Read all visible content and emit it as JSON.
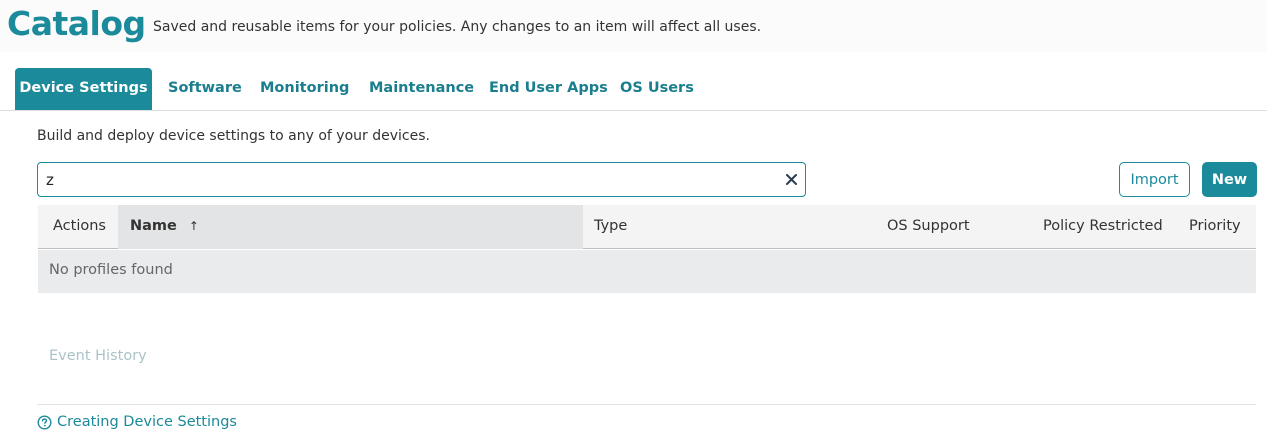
{
  "header": {
    "title": "Catalog",
    "subtitle": "Saved and reusable items for your policies. Any changes to an item will affect all uses."
  },
  "tabs": [
    {
      "label": "Device Settings",
      "active": true
    },
    {
      "label": "Software",
      "active": false
    },
    {
      "label": "Monitoring",
      "active": false
    },
    {
      "label": "Maintenance",
      "active": false
    },
    {
      "label": "End User Apps",
      "active": false
    },
    {
      "label": "OS Users",
      "active": false
    }
  ],
  "main": {
    "intro": "Build and deploy device settings to any of your devices.",
    "search": {
      "value": "z",
      "clear_icon": "close-icon"
    },
    "import_label": "Import",
    "new_label": "New"
  },
  "table": {
    "columns": [
      {
        "label": "Actions"
      },
      {
        "label": "Name",
        "sorted": true,
        "sort_icon": "↑"
      },
      {
        "label": "Type"
      },
      {
        "label": "OS Support"
      },
      {
        "label": "Policy Restricted"
      },
      {
        "label": "Priority"
      }
    ],
    "empty_text": "No profiles found"
  },
  "footer": {
    "event_history": "Event History",
    "help_label": "Creating Device Settings",
    "help_icon": "question-circle-icon"
  },
  "colors": {
    "accent": "#1b8a9a",
    "header_bg": "#f4f4f5",
    "empty_row_bg": "#eaebec"
  }
}
